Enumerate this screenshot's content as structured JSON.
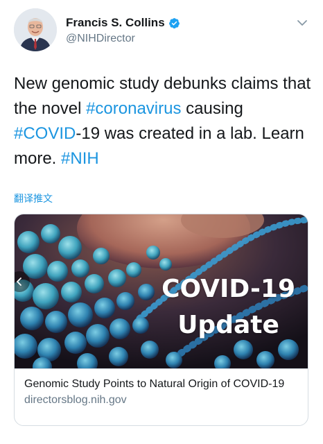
{
  "author": {
    "name": "Francis S. Collins",
    "handle": "@NIHDirector",
    "verified": true
  },
  "icons": {
    "verified": "verified-badge-icon",
    "menu": "chevron-down-icon",
    "prev": "chevron-left-icon"
  },
  "colors": {
    "accent": "#1b95e0",
    "text": "#14171a",
    "secondary": "#657786"
  },
  "tweet": {
    "segments": [
      {
        "text": "New genomic study debunks claims that the novel ",
        "hashtag": false
      },
      {
        "text": "#coronavirus",
        "hashtag": true
      },
      {
        "text": " causing ",
        "hashtag": false
      },
      {
        "text": "#COVID",
        "hashtag": true
      },
      {
        "text": "-19 was created in a lab. Learn more. ",
        "hashtag": false
      },
      {
        "text": "#NIH",
        "hashtag": true
      }
    ],
    "translate_label": "翻译推文"
  },
  "card": {
    "overlay_line1": "COVID-19",
    "overlay_line2": "Update",
    "title": "Genomic Study Points to Natural Origin of COVID-19",
    "domain": "directorsblog.nih.gov"
  }
}
